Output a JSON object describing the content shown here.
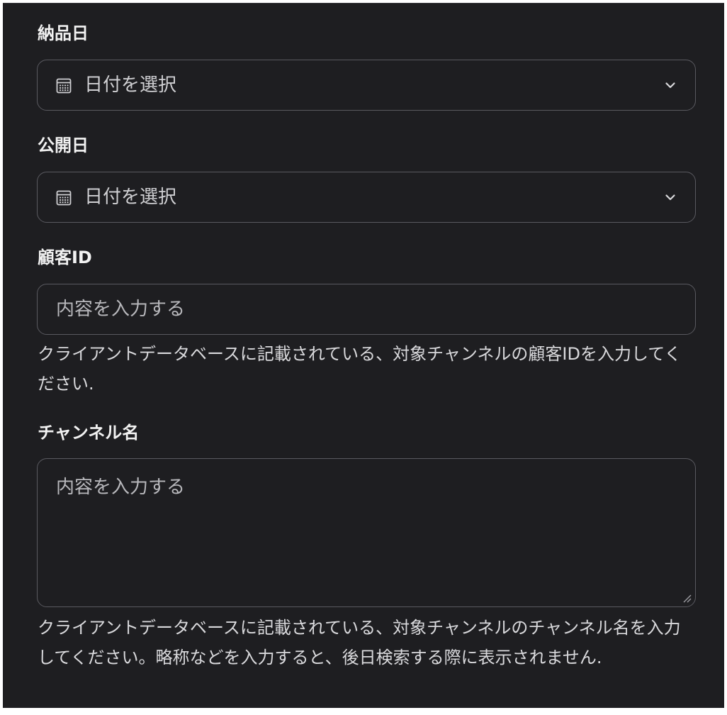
{
  "fields": {
    "delivery_date": {
      "label": "納品日",
      "value": "日付を選択",
      "icon": "calendar-icon"
    },
    "publish_date": {
      "label": "公開日",
      "value": "日付を選択",
      "icon": "calendar-icon"
    },
    "customer_id": {
      "label": "顧客ID",
      "placeholder": "内容を入力する",
      "help": "クライアントデータベースに記載されている、対象チャンネルの顧客IDを入力してください."
    },
    "channel_name": {
      "label": "チャンネル名",
      "placeholder": "内容を入力する",
      "help": "クライアントデータベースに記載されている、対象チャンネルのチャンネル名を入力してください。略称などを入力すると、後日検索する際に表示されません."
    }
  },
  "colors": {
    "background": "#1e1e21",
    "border": "#5a5a60",
    "label": "#f2f2f2",
    "text": "#cfcfd2"
  }
}
